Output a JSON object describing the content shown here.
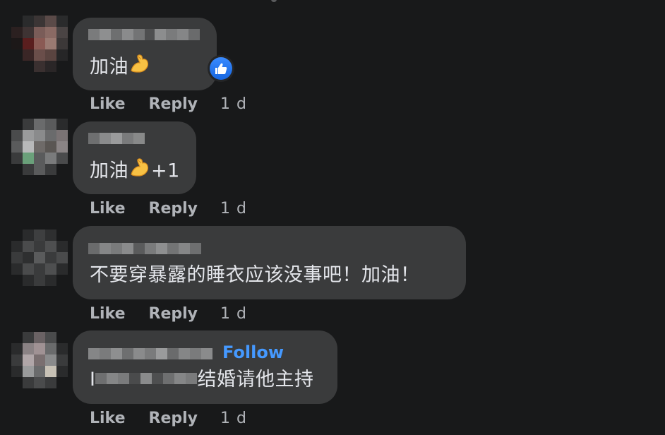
{
  "comments": [
    {
      "text": "加油",
      "emoji": "flexed-biceps",
      "reaction": "like-icon",
      "actions": {
        "like": "Like",
        "reply": "Reply",
        "time": "1 d"
      }
    },
    {
      "text": "加油",
      "emoji": "flexed-biceps",
      "suffix": "+1",
      "actions": {
        "like": "Like",
        "reply": "Reply",
        "time": "1 d"
      }
    },
    {
      "text": "不要穿暴露的睡衣应该没事吧！加油！",
      "actions": {
        "like": "Like",
        "reply": "Reply",
        "time": "1 d"
      }
    },
    {
      "follow": "Follow",
      "text_prefix": "I",
      "text": "结婚请他主持",
      "actions": {
        "like": "Like",
        "reply": "Reply",
        "time": "1 d"
      }
    }
  ],
  "colors": {
    "background": "#18191a",
    "bubble": "#3a3b3c",
    "text": "#e4e6eb",
    "secondary": "#b0b3b8",
    "follow": "#4599ff",
    "like_badge": "#1877f2"
  }
}
